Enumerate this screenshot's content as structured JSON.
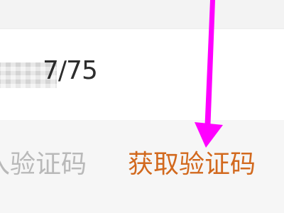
{
  "phone_field": {
    "visible_suffix": "7/75",
    "masked": true
  },
  "code_field": {
    "placeholder": "入验证码"
  },
  "get_code_button": {
    "label": "获取验证码",
    "color": "#d2691e"
  },
  "annotation": {
    "arrow_color": "#ff00ff",
    "icon": "arrow-down-icon"
  }
}
